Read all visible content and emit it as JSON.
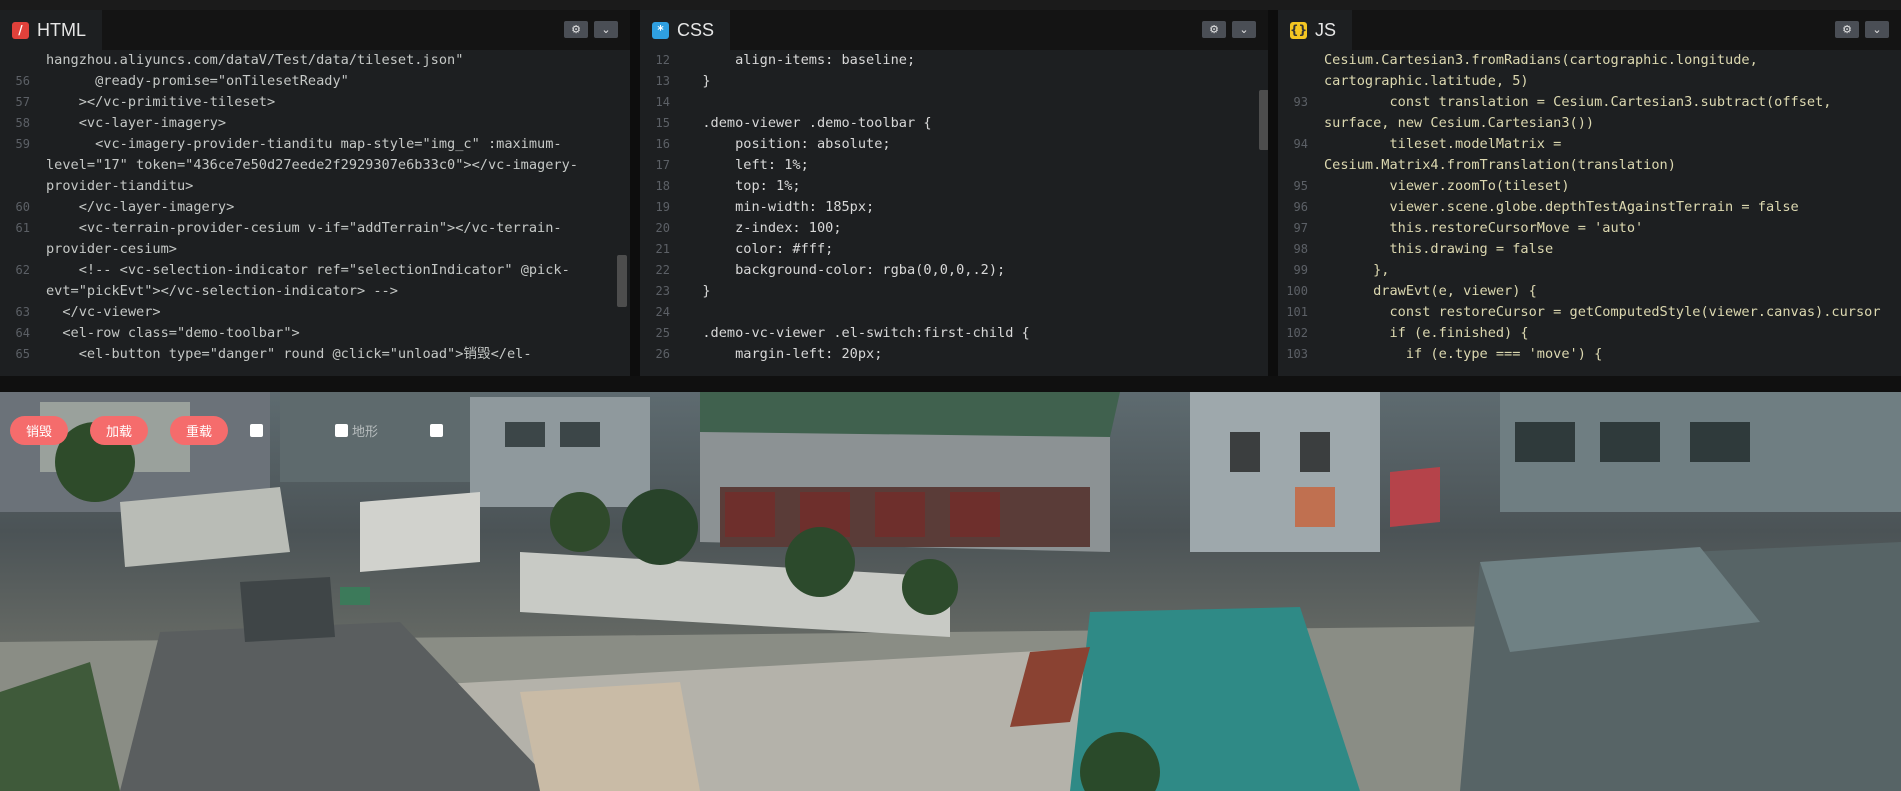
{
  "html_panel": {
    "tab_label": "HTML",
    "lines": [
      {
        "n": "",
        "t": "hangzhou.aliyuncs.com/dataV/Test/data/tileset.json\""
      },
      {
        "n": "56",
        "t": "      @ready-promise=\"onTilesetReady\""
      },
      {
        "n": "57",
        "t": "    ></vc-primitive-tileset>"
      },
      {
        "n": "58",
        "t": "    <vc-layer-imagery>"
      },
      {
        "n": "59",
        "t": "      <vc-imagery-provider-tianditu map-style=\"img_c\" :maximum-level=\"17\" token=\"436ce7e50d27eede2f2929307e6b33c0\"></vc-imagery-provider-tianditu>"
      },
      {
        "n": "60",
        "t": "    </vc-layer-imagery>"
      },
      {
        "n": "61",
        "t": "    <vc-terrain-provider-cesium v-if=\"addTerrain\"></vc-terrain-provider-cesium>"
      },
      {
        "n": "62",
        "t": "    <!-- <vc-selection-indicator ref=\"selectionIndicator\" @pick-evt=\"pickEvt\"></vc-selection-indicator> -->"
      },
      {
        "n": "63",
        "t": "  </vc-viewer>"
      },
      {
        "n": "64",
        "t": "  <el-row class=\"demo-toolbar\">"
      },
      {
        "n": "65",
        "t": "    <el-button type=\"danger\" round @click=\"unload\">销毁</el-"
      }
    ]
  },
  "css_panel": {
    "tab_label": "CSS",
    "lines": [
      {
        "n": "12",
        "t": "      align-items: baseline;"
      },
      {
        "n": "13",
        "t": "  }"
      },
      {
        "n": "14",
        "t": ""
      },
      {
        "n": "15",
        "t": "  .demo-viewer .demo-toolbar {"
      },
      {
        "n": "16",
        "t": "      position: absolute;"
      },
      {
        "n": "17",
        "t": "      left: 1%;"
      },
      {
        "n": "18",
        "t": "      top: 1%;"
      },
      {
        "n": "19",
        "t": "      min-width: 185px;"
      },
      {
        "n": "20",
        "t": "      z-index: 100;"
      },
      {
        "n": "21",
        "t": "      color: #fff;"
      },
      {
        "n": "22",
        "t": "      background-color: rgba(0,0,0,.2);"
      },
      {
        "n": "23",
        "t": "  }"
      },
      {
        "n": "24",
        "t": ""
      },
      {
        "n": "25",
        "t": "  .demo-vc-viewer .el-switch:first-child {"
      },
      {
        "n": "26",
        "t": "      margin-left: 20px;"
      }
    ]
  },
  "js_panel": {
    "tab_label": "JS",
    "lines": [
      {
        "n": "",
        "t": "Cesium.Cartesian3.fromRadians(cartographic.longitude, cartographic.latitude, 5)"
      },
      {
        "n": "93",
        "t": "        const translation = Cesium.Cartesian3.subtract(offset, surface, new Cesium.Cartesian3())"
      },
      {
        "n": "94",
        "t": "        tileset.modelMatrix = Cesium.Matrix4.fromTranslation(translation)"
      },
      {
        "n": "95",
        "t": "        viewer.zoomTo(tileset)"
      },
      {
        "n": "96",
        "t": "        viewer.scene.globe.depthTestAgainstTerrain = false"
      },
      {
        "n": "97",
        "t": "        this.restoreCursorMove = 'auto'"
      },
      {
        "n": "98",
        "t": "        this.drawing = false"
      },
      {
        "n": "99",
        "t": "      },"
      },
      {
        "n": "100",
        "t": "      drawEvt(e, viewer) {"
      },
      {
        "n": "101",
        "t": "        const restoreCursor = getComputedStyle(viewer.canvas).cursor"
      },
      {
        "n": "102",
        "t": "        if (e.finished) {"
      },
      {
        "n": "103",
        "t": "          if (e.type === 'move') {"
      }
    ]
  },
  "viewer": {
    "toolbar": {
      "destroy_label": "销毁",
      "load_label": "加载",
      "reload_label": "重载",
      "terrain_label": "地形"
    }
  },
  "icons": {
    "settings": "gear-icon",
    "dropdown": "chevron-down-icon"
  },
  "colors": {
    "danger_button": "#f56c6c",
    "html_badge": "#e0413b",
    "css_badge": "#2f9fe0",
    "js_badge": "#f4c622"
  }
}
